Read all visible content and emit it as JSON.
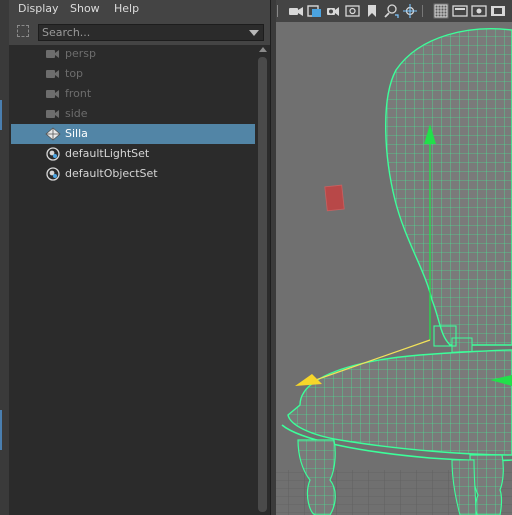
{
  "menu": {
    "display": "Display",
    "show": "Show",
    "help": "Help"
  },
  "search": {
    "placeholder": "Search..."
  },
  "outliner": {
    "items": [
      {
        "label": "persp",
        "icon": "camera-icon",
        "state": "hidden"
      },
      {
        "label": "top",
        "icon": "camera-icon",
        "state": "hidden"
      },
      {
        "label": "front",
        "icon": "camera-icon",
        "state": "hidden"
      },
      {
        "label": "side",
        "icon": "camera-icon",
        "state": "hidden"
      },
      {
        "label": "Silla",
        "icon": "mesh-object-icon",
        "state": "selected"
      },
      {
        "label": "defaultLightSet",
        "icon": "set-icon",
        "state": "normal"
      },
      {
        "label": "defaultObjectSet",
        "icon": "set-icon",
        "state": "normal"
      }
    ]
  },
  "viewport_toolbar": {
    "icons": [
      "camera-icon",
      "camera-attributes-icon",
      "bookmark-icon",
      "image-plane-icon",
      "pin-icon",
      "2d-pan-zoom-icon",
      "grease-pencil-icon",
      "grid-icon",
      "film-gate-icon",
      "resolution-gate-icon",
      "gate-mask-icon"
    ]
  },
  "colors": {
    "selection": "#5285a6",
    "wireframe": "#3cff9a",
    "panel_bg": "#2b2b2b",
    "viewport_bg": "#707070"
  }
}
